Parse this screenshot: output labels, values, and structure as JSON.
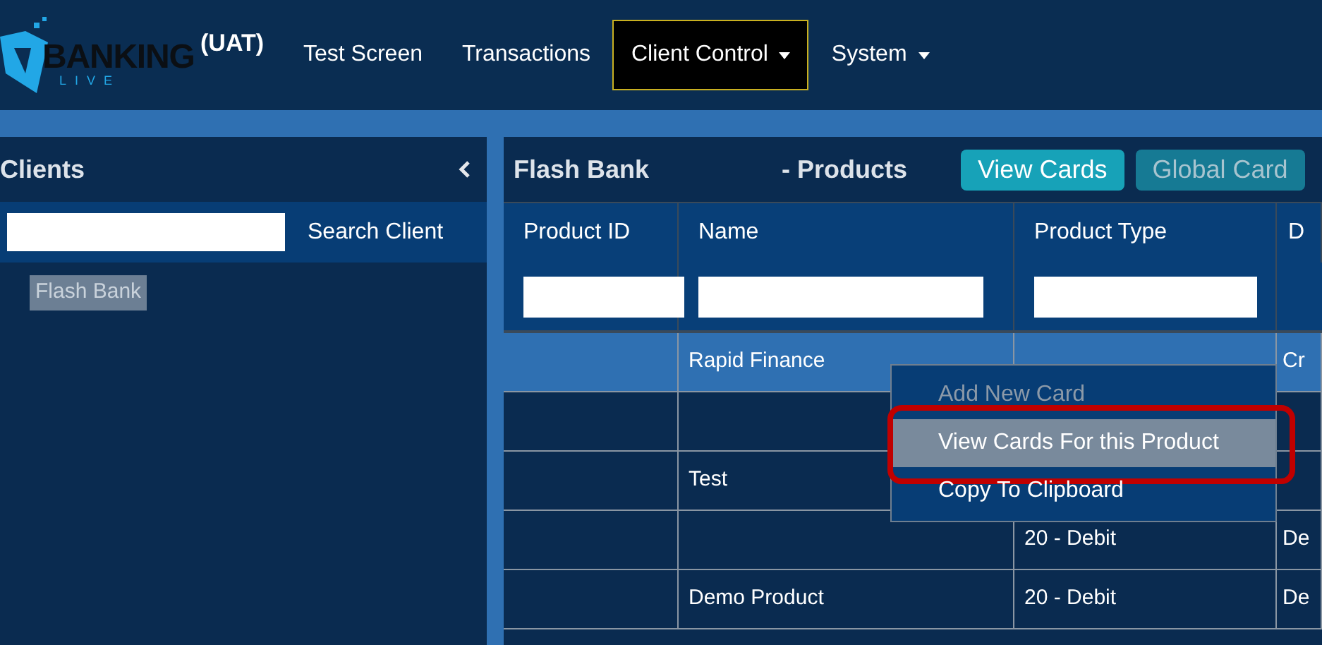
{
  "logo": {
    "name": "BANKING",
    "sub": "LIVE"
  },
  "environment": "(UAT)",
  "nav": [
    {
      "label": "Test Screen",
      "dropdown": false,
      "selected": false
    },
    {
      "label": "Transactions",
      "dropdown": false,
      "selected": false
    },
    {
      "label": "Client Control",
      "dropdown": true,
      "selected": true
    },
    {
      "label": "System",
      "dropdown": true,
      "selected": false
    }
  ],
  "clients_panel": {
    "title": "Clients",
    "search": {
      "button": "Search Client"
    },
    "items": [
      {
        "label": "Flash Bank",
        "selected": true
      }
    ]
  },
  "products_panel": {
    "client": "Flash Bank",
    "title": "- Products",
    "buttons": [
      {
        "label": "View Cards",
        "disabled": false
      },
      {
        "label": "Global Card",
        "disabled": true
      }
    ],
    "table": {
      "columns": [
        "Product ID",
        "Name",
        "Product Type",
        "D"
      ],
      "rows": [
        {
          "cells": [
            "",
            "Rapid Finance",
            "",
            "Cr"
          ],
          "selected": true
        },
        {
          "cells": [
            "",
            "",
            "",
            ""
          ],
          "selected": false
        },
        {
          "cells": [
            "",
            "Test",
            "",
            ""
          ],
          "selected": false
        },
        {
          "cells": [
            "",
            "",
            "20 - Debit",
            "De"
          ],
          "selected": false
        },
        {
          "cells": [
            "",
            "Demo Product",
            "20 - Debit",
            "De"
          ],
          "selected": false
        }
      ]
    }
  },
  "context_menu": {
    "items": [
      {
        "label": "Add New Card",
        "disabled": true,
        "selected": false,
        "highlighted": false
      },
      {
        "label": "View Cards For this Product",
        "disabled": false,
        "selected": true,
        "highlighted": true
      },
      {
        "label": "Copy To Clipboard",
        "disabled": false,
        "selected": false,
        "highlighted": false
      }
    ]
  }
}
